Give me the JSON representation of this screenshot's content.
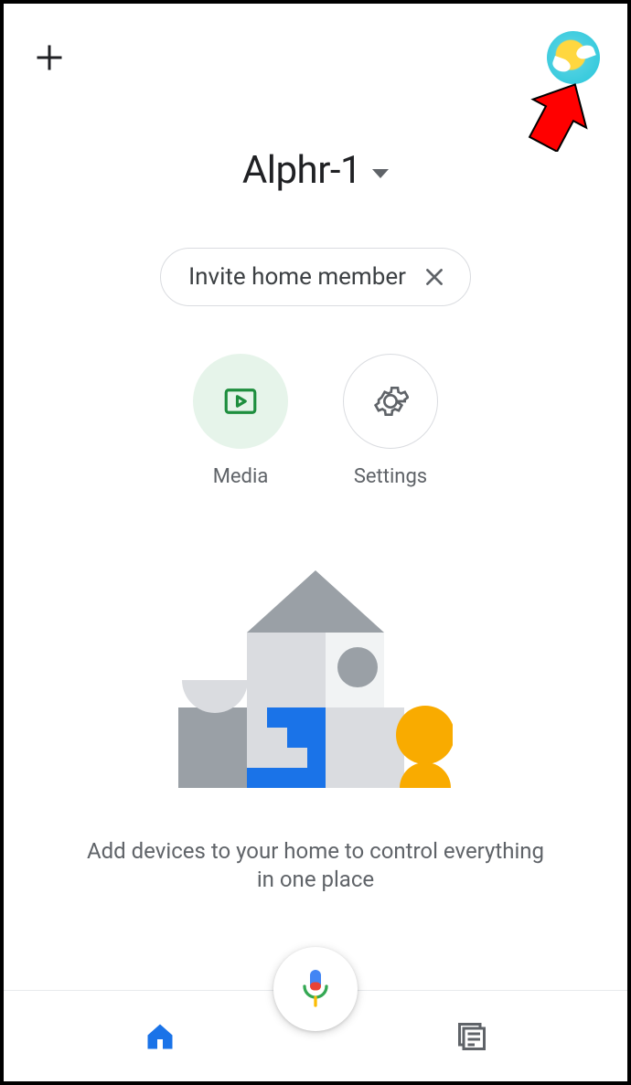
{
  "header": {
    "home_name": "Alphr-1"
  },
  "invite": {
    "label": "Invite home member"
  },
  "actions": {
    "media": "Media",
    "settings": "Settings"
  },
  "empty_state": {
    "message": "Add devices to your home to control everything in one place"
  },
  "icons": {
    "add": "plus-icon",
    "avatar": "profile-avatar",
    "caret": "chevron-down-icon",
    "close": "close-icon",
    "media": "play-icon",
    "settings": "gear-icon",
    "mic": "microphone-icon",
    "home_tab": "home-icon",
    "feed_tab": "feed-icon"
  },
  "colors": {
    "primary_blue": "#1a73e8",
    "green": "#34a853",
    "grey_text": "#5f6368",
    "media_bg": "#e6f4ea",
    "accent_yellow": "#f9ab00"
  },
  "nav": {
    "active": "home"
  }
}
